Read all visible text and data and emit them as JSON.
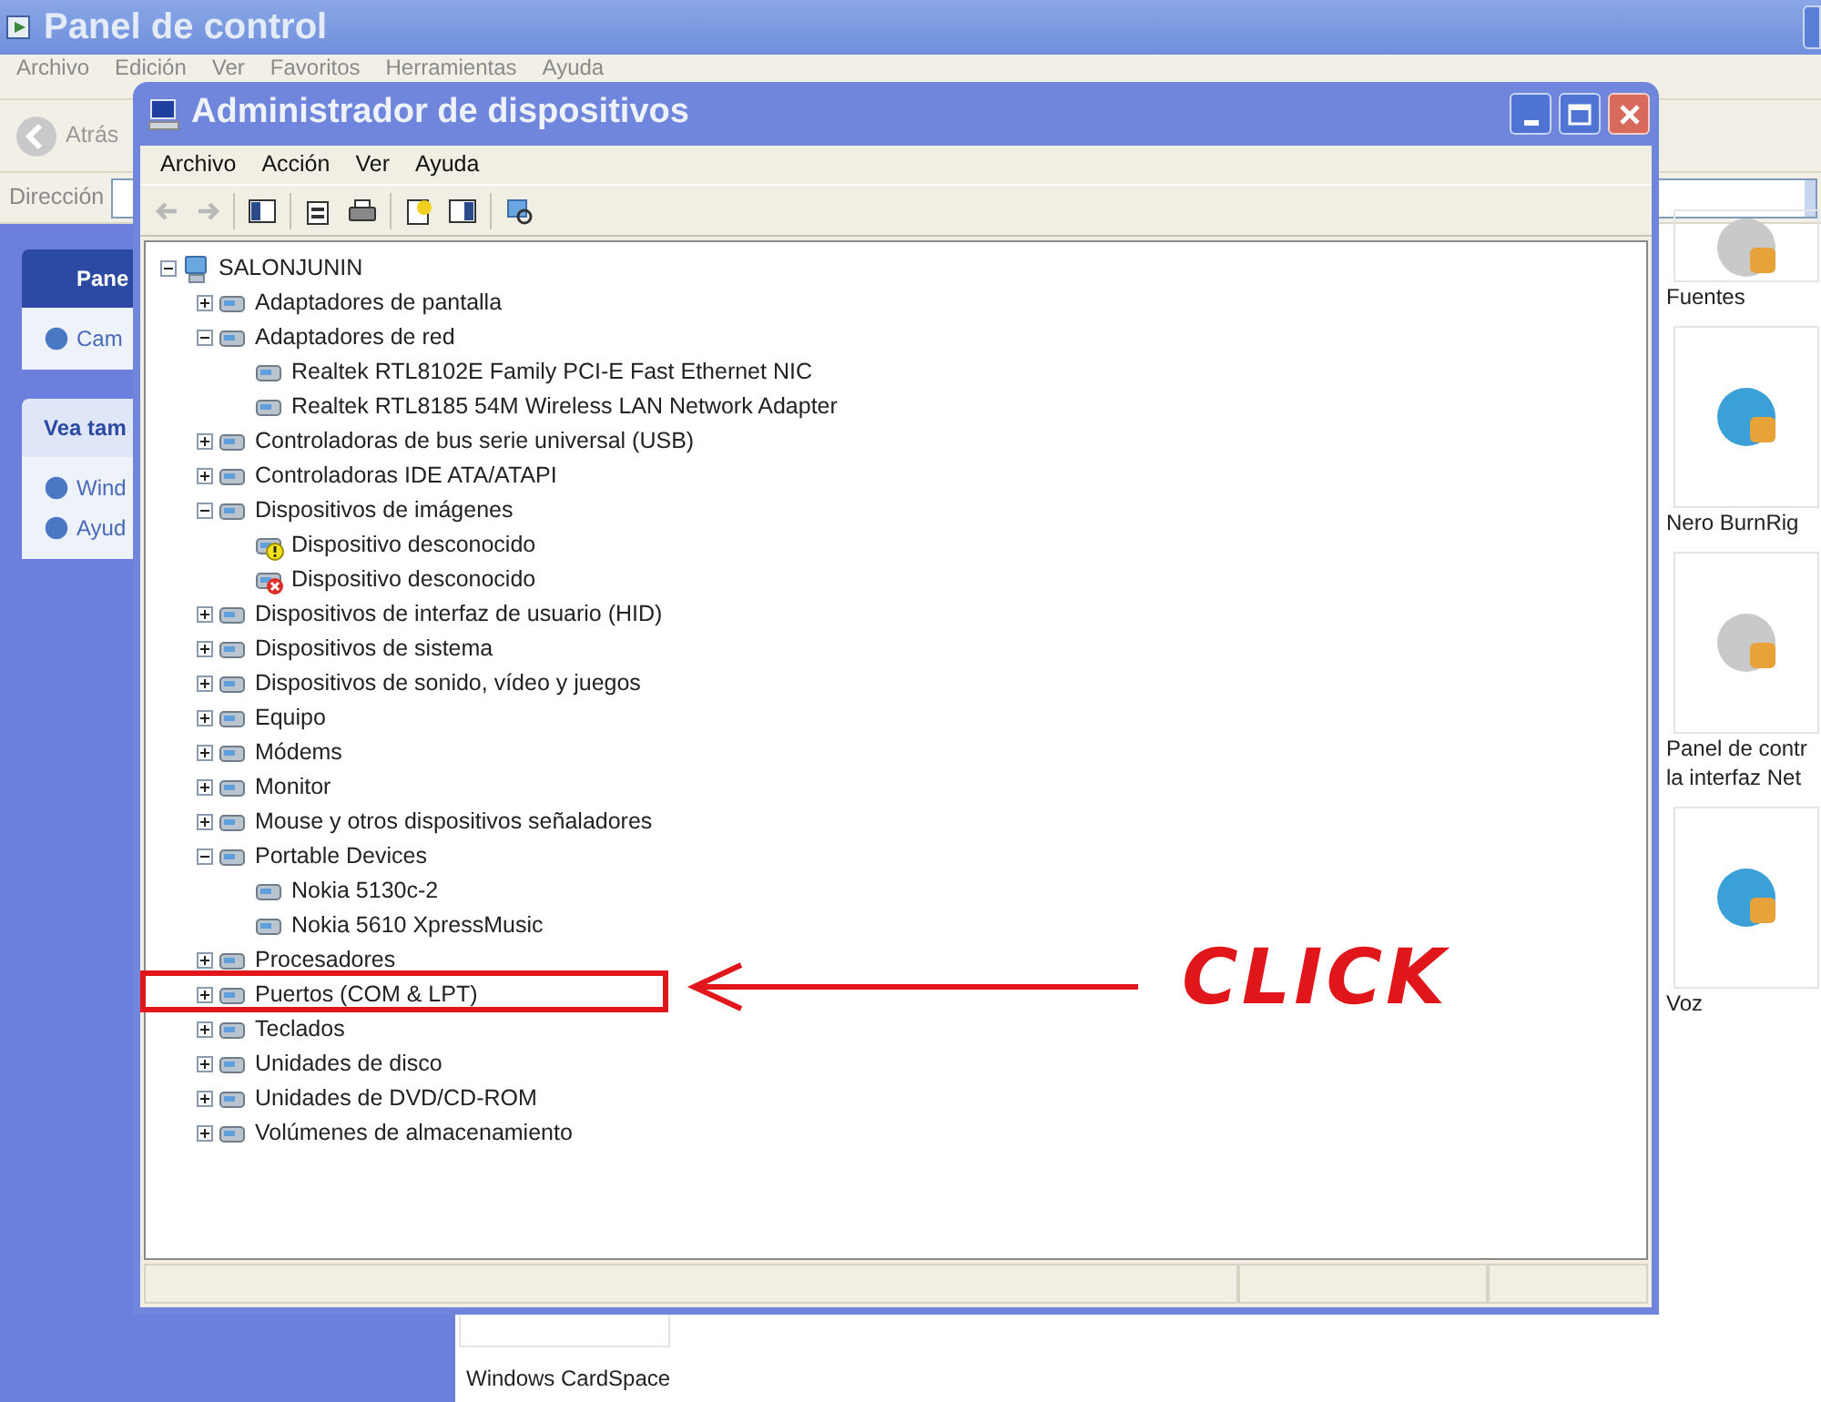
{
  "back_window": {
    "title": "Panel de control",
    "menu": [
      "Archivo",
      "Edición",
      "Ver",
      "Favoritos",
      "Herramientas",
      "Ayuda"
    ],
    "back_button": "Atrás",
    "address_label": "Dirección",
    "task_panels": [
      {
        "kind": "primary",
        "title": "Pane",
        "items": [
          "Cam"
        ]
      },
      {
        "kind": "plain",
        "title": "Vea tam",
        "items": [
          "Wind",
          "Ayud"
        ]
      }
    ],
    "items": [
      {
        "lines": [
          "Fuentes"
        ]
      },
      {
        "lines": [
          "Nero BurnRig"
        ]
      },
      {
        "lines": [
          "Panel de contr",
          "la interfaz Net"
        ]
      },
      {
        "lines": [
          "Voz"
        ]
      }
    ],
    "bottom_item": "Windows CardSpace"
  },
  "device_manager": {
    "title": "Administrador de dispositivos",
    "menu": [
      "Archivo",
      "Acción",
      "Ver",
      "Ayuda"
    ],
    "nav_buttons": [
      {
        "disabled": true
      },
      {
        "disabled": true
      }
    ],
    "tree": {
      "label": "SALONJUNIN",
      "expanded": true,
      "children": [
        {
          "label": "Adaptadores de pantalla",
          "expanded": false
        },
        {
          "label": "Adaptadores de red",
          "expanded": true,
          "children": [
            {
              "label": "Realtek RTL8102E Family PCI-E Fast Ethernet NIC"
            },
            {
              "label": "Realtek RTL8185 54M Wireless LAN Network Adapter"
            }
          ]
        },
        {
          "label": "Controladoras de bus serie universal (USB)",
          "expanded": false
        },
        {
          "label": "Controladoras IDE ATA/ATAPI",
          "expanded": false
        },
        {
          "label": "Dispositivos de imágenes",
          "expanded": true,
          "children": [
            {
              "label": "Dispositivo desconocido",
              "kind": "warning"
            },
            {
              "label": "Dispositivo desconocido",
              "kind": "disabled"
            }
          ]
        },
        {
          "label": "Dispositivos de interfaz de usuario (HID)",
          "expanded": false
        },
        {
          "label": "Dispositivos de sistema",
          "expanded": false
        },
        {
          "label": "Dispositivos de sonido, vídeo y juegos",
          "expanded": false
        },
        {
          "label": "Equipo",
          "expanded": false
        },
        {
          "label": "Módems",
          "expanded": false
        },
        {
          "label": "Monitor",
          "expanded": false
        },
        {
          "label": "Mouse y otros dispositivos señaladores",
          "expanded": false
        },
        {
          "label": "Portable Devices",
          "expanded": true,
          "children": [
            {
              "label": "Nokia 5130c-2"
            },
            {
              "label": "Nokia 5610 XpressMusic"
            }
          ]
        },
        {
          "label": "Procesadores",
          "expanded": false
        },
        {
          "label": "Puertos (COM & LPT)",
          "expanded": false
        },
        {
          "label": "Teclados",
          "expanded": false
        },
        {
          "label": "Unidades de disco",
          "expanded": false
        },
        {
          "label": "Unidades de DVD/CD-ROM",
          "expanded": false
        },
        {
          "label": "Volúmenes de almacenamiento",
          "expanded": false
        }
      ]
    }
  },
  "annotation": {
    "label": "CLICK"
  }
}
